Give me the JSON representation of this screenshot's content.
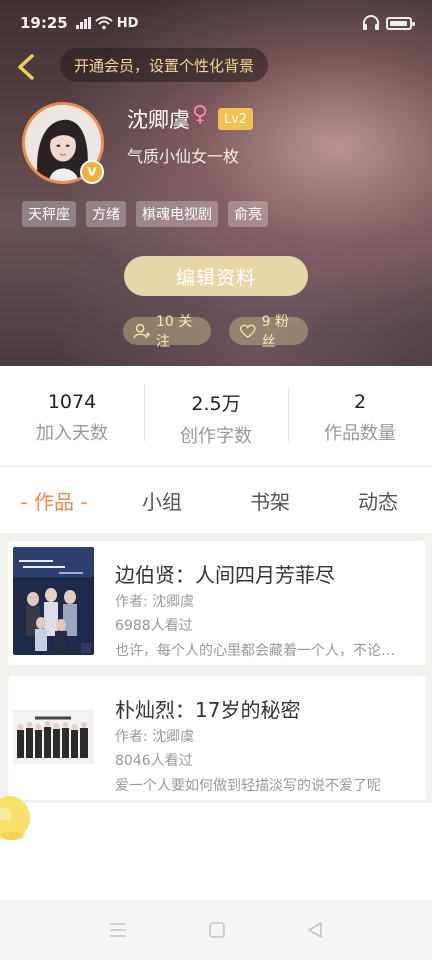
{
  "status_bar": {
    "time": "19:25",
    "network": "HD",
    "icons": [
      "signal-icon",
      "wifi-icon",
      "headphones-icon",
      "battery-icon"
    ]
  },
  "header": {
    "vip_banner": "开通会员，设置个性化背景",
    "username": "沈卿虞",
    "gender_symbol": "♀",
    "level": "Lv2",
    "verified_badge": "V",
    "bio": "气质小仙女一枚",
    "tags": [
      "天秤座",
      "方绪",
      "棋魂电视剧",
      "俞亮"
    ],
    "edit_button": "编辑资料",
    "follow_label": "10 关注",
    "fans_label": "9 粉丝"
  },
  "stats": [
    {
      "value": "1074",
      "label": "加入天数"
    },
    {
      "value": "2.5万",
      "label": "创作字数"
    },
    {
      "value": "2",
      "label": "作品数量"
    }
  ],
  "tabs": [
    {
      "label": "- 作品 -",
      "active": true
    },
    {
      "label": "小组",
      "active": false
    },
    {
      "label": "书架",
      "active": false
    },
    {
      "label": "动态",
      "active": false
    }
  ],
  "works": [
    {
      "title": "边伯贤：人间四月芳菲尽",
      "author": "作者: 沈卿虞",
      "views": "6988人看过",
      "desc": "也许，每个人的心里都会藏着一个人，不论时间如何流逝"
    },
    {
      "title": "朴灿烈：17岁的秘密",
      "author": "作者: 沈卿虞",
      "views": "8046人看过",
      "desc": "爱一个人要如何做到轻描淡写的说不爱了呢"
    }
  ],
  "colors": {
    "accent": "#f08a4b",
    "gold": "#f2d894",
    "edit_button": "#e6d6a8"
  }
}
